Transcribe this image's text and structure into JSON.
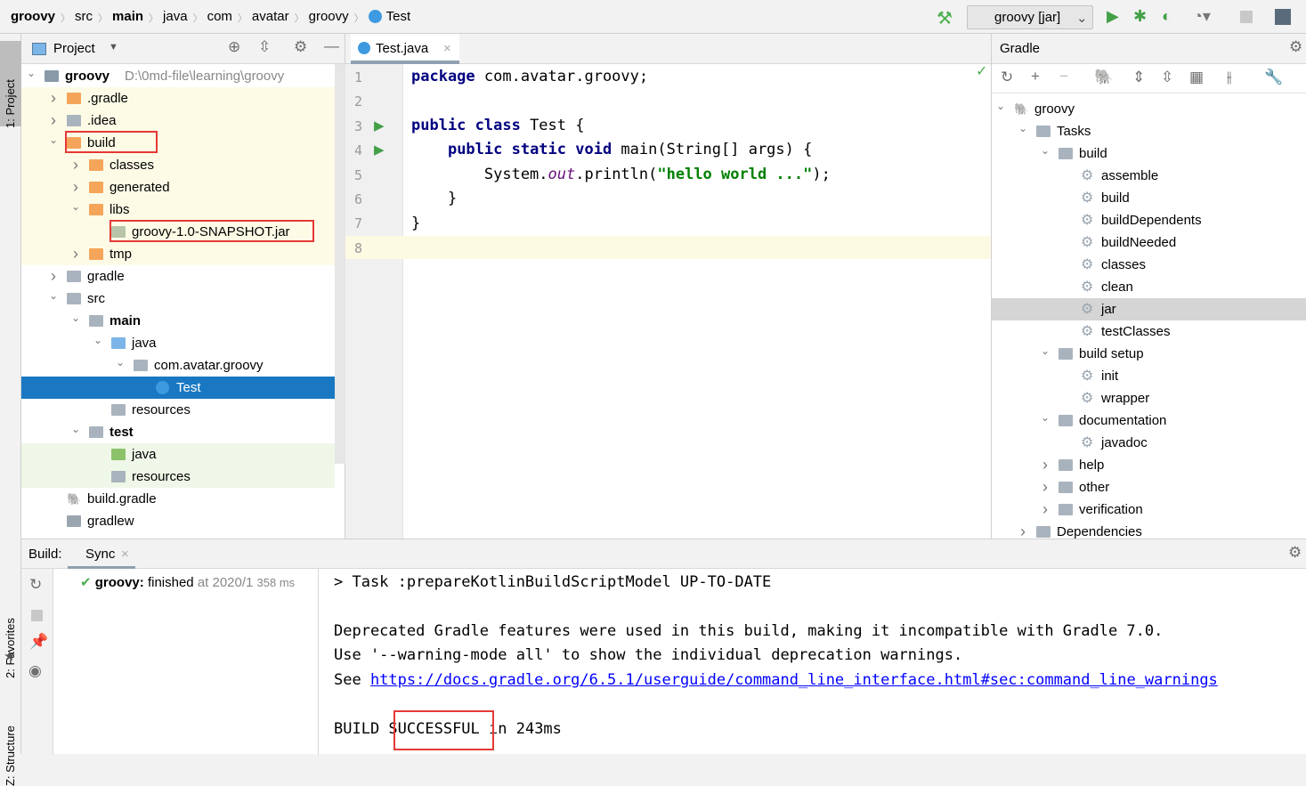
{
  "breadcrumb": [
    {
      "t": "groovy",
      "b": true
    },
    {
      "t": "src"
    },
    {
      "t": "main",
      "b": true
    },
    {
      "t": "java"
    },
    {
      "t": "com"
    },
    {
      "t": "avatar"
    },
    {
      "t": "groovy"
    },
    {
      "t": "Test",
      "icon": "class-icon"
    }
  ],
  "run_config": "groovy [jar]",
  "left_strip": {
    "project": "1: Project",
    "favorites": "2: Favorites",
    "structure": "Z: Structure"
  },
  "project": {
    "title": "Project",
    "rows": [
      {
        "t": "groovy",
        "b": true,
        "extra": "D:\\0md-file\\learning\\groovy",
        "lvl": 0,
        "arr": "v",
        "ic": "module-icon"
      },
      {
        "t": ".gradle",
        "lvl": 1,
        "arr": ">",
        "ic": "folder-orange",
        "bg": "y"
      },
      {
        "t": ".idea",
        "lvl": 1,
        "arr": ">",
        "ic": "folder-gray",
        "bg": "y"
      },
      {
        "t": "build",
        "lvl": 1,
        "arr": "v",
        "ic": "folder-orange",
        "bg": "y",
        "box": true
      },
      {
        "t": "classes",
        "lvl": 2,
        "arr": ">",
        "ic": "folder-orange",
        "bg": "y"
      },
      {
        "t": "generated",
        "lvl": 2,
        "arr": ">",
        "ic": "folder-orange",
        "bg": "y"
      },
      {
        "t": "libs",
        "lvl": 2,
        "arr": "v",
        "ic": "folder-orange",
        "bg": "y"
      },
      {
        "t": "groovy-1.0-SNAPSHOT.jar",
        "lvl": 3,
        "ic": "jar-icon",
        "bg": "y",
        "box": true
      },
      {
        "t": "tmp",
        "lvl": 2,
        "arr": ">",
        "ic": "folder-orange",
        "bg": "y"
      },
      {
        "t": "gradle",
        "lvl": 1,
        "arr": ">",
        "ic": "folder-gray"
      },
      {
        "t": "src",
        "lvl": 1,
        "arr": "v",
        "ic": "folder-gray"
      },
      {
        "t": "main",
        "b": true,
        "lvl": 2,
        "arr": "v",
        "ic": "folder-gray"
      },
      {
        "t": "java",
        "lvl": 3,
        "arr": "v",
        "ic": "folder-blue"
      },
      {
        "t": "com.avatar.groovy",
        "lvl": 4,
        "arr": "v",
        "ic": "package-icon"
      },
      {
        "t": "Test",
        "lvl": 5,
        "ic": "class-icon",
        "sel": true
      },
      {
        "t": "resources",
        "lvl": 3,
        "ic": "resources-icon"
      },
      {
        "t": "test",
        "b": true,
        "lvl": 2,
        "arr": "v",
        "ic": "folder-gray"
      },
      {
        "t": "java",
        "lvl": 3,
        "ic": "folder-green",
        "bg": "g"
      },
      {
        "t": "resources",
        "lvl": 3,
        "ic": "resources-icon",
        "bg": "g"
      },
      {
        "t": "build.gradle",
        "lvl": 1,
        "ic": "gradle-icon"
      },
      {
        "t": "gradlew",
        "lvl": 1,
        "ic": "file-icon"
      }
    ]
  },
  "editor": {
    "tab": "Test.java",
    "lines": [
      "1",
      "2",
      "3",
      "4",
      "5",
      "6",
      "7",
      "8"
    ]
  },
  "gradle": {
    "title": "Gradle",
    "rows": [
      {
        "t": "groovy",
        "lvl": 0,
        "arr": "v",
        "ic": "elephant"
      },
      {
        "t": "Tasks",
        "lvl": 1,
        "arr": "v",
        "ic": "taskfolder"
      },
      {
        "t": "build",
        "lvl": 2,
        "arr": "v",
        "ic": "taskfolder"
      },
      {
        "t": "assemble",
        "lvl": 3,
        "ic": "gear"
      },
      {
        "t": "build",
        "lvl": 3,
        "ic": "gear"
      },
      {
        "t": "buildDependents",
        "lvl": 3,
        "ic": "gear"
      },
      {
        "t": "buildNeeded",
        "lvl": 3,
        "ic": "gear"
      },
      {
        "t": "classes",
        "lvl": 3,
        "ic": "gear"
      },
      {
        "t": "clean",
        "lvl": 3,
        "ic": "gear"
      },
      {
        "t": "jar",
        "lvl": 3,
        "ic": "gear",
        "sel": true
      },
      {
        "t": "testClasses",
        "lvl": 3,
        "ic": "gear"
      },
      {
        "t": "build setup",
        "lvl": 2,
        "arr": "v",
        "ic": "taskfolder"
      },
      {
        "t": "init",
        "lvl": 3,
        "ic": "gear"
      },
      {
        "t": "wrapper",
        "lvl": 3,
        "ic": "gear"
      },
      {
        "t": "documentation",
        "lvl": 2,
        "arr": "v",
        "ic": "taskfolder"
      },
      {
        "t": "javadoc",
        "lvl": 3,
        "ic": "gear"
      },
      {
        "t": "help",
        "lvl": 2,
        "arr": ">",
        "ic": "taskfolder"
      },
      {
        "t": "other",
        "lvl": 2,
        "arr": ">",
        "ic": "taskfolder"
      },
      {
        "t": "verification",
        "lvl": 2,
        "arr": ">",
        "ic": "taskfolder"
      },
      {
        "t": "Dependencies",
        "lvl": 1,
        "arr": ">",
        "ic": "taskfolder"
      }
    ]
  },
  "build": {
    "label": "Build:",
    "tab": "Sync",
    "status_name": "groovy:",
    "status": "finished",
    "at": "at 2020/1",
    "time": "358 ms",
    "console": {
      "l1": "> Task :prepareKotlinBuildScriptModel UP-TO-DATE",
      "l2": "Deprecated Gradle features were used in this build, making it incompatible with Gradle 7.0.",
      "l3": "Use '--warning-mode all' to show the individual deprecation warnings.",
      "l4a": "See ",
      "link": "https://docs.gradle.org/6.5.1/userguide/command_line_interface.html#sec:command_line_warnings",
      "l5a": "BUILD ",
      "l5b": "SUCCESSFUL",
      "l5c": " in 243ms"
    }
  },
  "colors": {
    "selection": "#1a78c2",
    "highlight_box": "#e53935",
    "link": "#0000ff",
    "keyword": "#000080",
    "string": "#008000"
  }
}
